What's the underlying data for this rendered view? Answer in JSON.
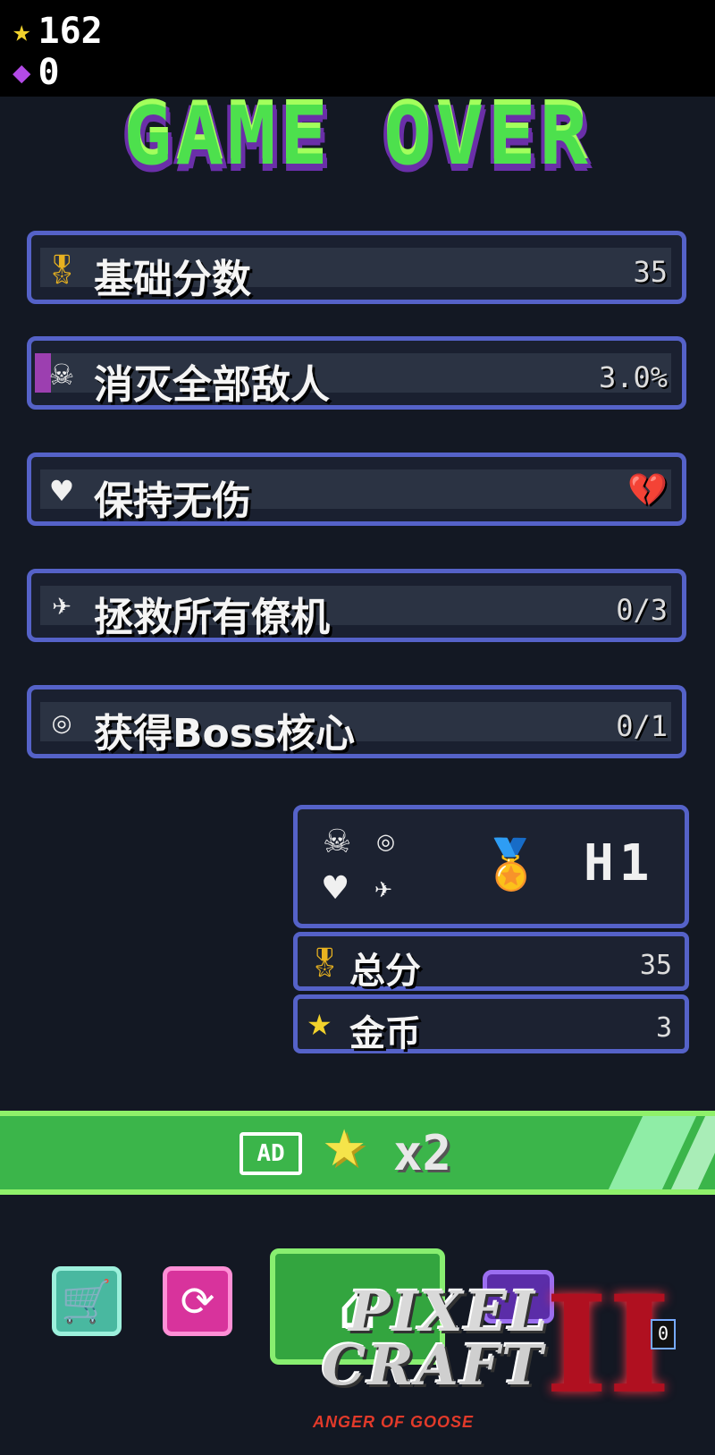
{
  "hud": {
    "coins": "162",
    "gems": "0",
    "coin_icon": "star-icon",
    "gem_icon": "gem-icon"
  },
  "title": "GAME OVER",
  "stats": [
    {
      "label": "基础分数",
      "value": "35",
      "icon": "medal-icon"
    },
    {
      "label": "消灭全部敌人",
      "value": "3.0%",
      "icon": "skull-icon",
      "progress": 0.03
    },
    {
      "label": "保持无伤",
      "value": "",
      "icon": "heart-icon"
    },
    {
      "label": "拯救所有僚机",
      "value": "0/3",
      "icon": "wingman-icon"
    },
    {
      "label": "获得Boss核心",
      "value": "0/1",
      "icon": "core-icon"
    }
  ],
  "summary": {
    "rank": "H1",
    "total_label": "总分",
    "total_value": "35",
    "coins_label": "金币",
    "coins_value": "3"
  },
  "ad_bonus": {
    "badge": "AD",
    "multiplier": "x2"
  },
  "logo": {
    "line1": "PIXEL",
    "line2": "CRAFT",
    "numeral": "II",
    "subtitle": "ANGER OF GOOSE"
  },
  "badge_count": "0",
  "colors": {
    "panel_border": "#5562c8",
    "title_green": "#4de04d",
    "ad_green": "#3bb54a"
  }
}
